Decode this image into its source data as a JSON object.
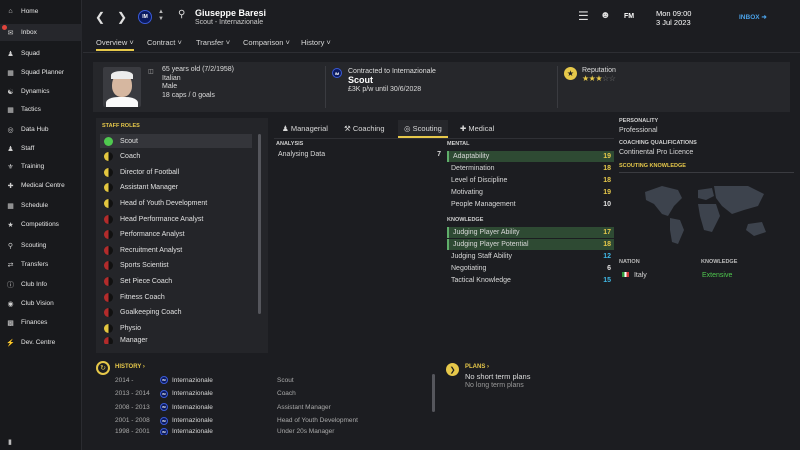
{
  "sidebar": {
    "items": [
      {
        "label": "Home",
        "icon": "home-icon"
      },
      {
        "label": "Inbox",
        "icon": "inbox-icon"
      },
      {
        "label": "Squad",
        "icon": "squad-icon"
      },
      {
        "label": "Squad Planner",
        "icon": "planner-icon"
      },
      {
        "label": "Dynamics",
        "icon": "dynamics-icon"
      },
      {
        "label": "Tactics",
        "icon": "tactics-icon"
      },
      {
        "label": "Data Hub",
        "icon": "datahub-icon"
      },
      {
        "label": "Staff",
        "icon": "staff-icon"
      },
      {
        "label": "Training",
        "icon": "training-icon"
      },
      {
        "label": "Medical Centre",
        "icon": "medical-icon"
      },
      {
        "label": "Schedule",
        "icon": "schedule-icon"
      },
      {
        "label": "Competitions",
        "icon": "trophy-icon"
      },
      {
        "label": "Scouting",
        "icon": "scouting-icon"
      },
      {
        "label": "Transfers",
        "icon": "transfers-icon"
      },
      {
        "label": "Club Info",
        "icon": "clubinfo-icon"
      },
      {
        "label": "Club Vision",
        "icon": "vision-icon"
      },
      {
        "label": "Finances",
        "icon": "finances-icon"
      },
      {
        "label": "Dev. Centre",
        "icon": "devcentre-icon"
      }
    ]
  },
  "header": {
    "name": "Giuseppe Baresi",
    "subtitle": "Scout - Internazionale",
    "fm": "FM",
    "day": "Mon 09:00",
    "date": "3 Jul 2023",
    "inbox": "INBOX"
  },
  "subnav": {
    "tabs": [
      "Overview",
      "Contract",
      "Transfer",
      "Comparison",
      "History"
    ]
  },
  "profile": {
    "age": "65 years old (7/2/1958)",
    "nationality": "Italian",
    "gender": "Male",
    "caps": "18 caps / 0 goals",
    "contract_label": "Contracted to Internazionale",
    "role": "Scout",
    "wage": "£3K p/w until 30/6/2028",
    "reputation_label": "Reputation",
    "reputation_stars": 3
  },
  "staff_roles": {
    "title": "STAFF ROLES",
    "roles": [
      {
        "label": "Scout",
        "dot": "full-g"
      },
      {
        "label": "Coach",
        "dot": "half-y"
      },
      {
        "label": "Director of Football",
        "dot": "half-y"
      },
      {
        "label": "Assistant Manager",
        "dot": "half-y"
      },
      {
        "label": "Head of Youth Development",
        "dot": "half-y"
      },
      {
        "label": "Head Performance Analyst",
        "dot": "half-r"
      },
      {
        "label": "Performance Analyst",
        "dot": "half-r"
      },
      {
        "label": "Recruitment Analyst",
        "dot": "half-r"
      },
      {
        "label": "Sports Scientist",
        "dot": "half-r"
      },
      {
        "label": "Set Piece Coach",
        "dot": "half-r"
      },
      {
        "label": "Fitness Coach",
        "dot": "half-r"
      },
      {
        "label": "Goalkeeping Coach",
        "dot": "half-r"
      },
      {
        "label": "Physio",
        "dot": "half-y"
      },
      {
        "label": "Manager",
        "dot": "half-r"
      }
    ]
  },
  "attr_tabs": [
    "Managerial",
    "Coaching",
    "Scouting",
    "Medical"
  ],
  "analysis": {
    "title": "ANALYSIS",
    "items": [
      {
        "label": "Analysing Data",
        "value": "7"
      }
    ]
  },
  "mental": {
    "title": "MENTAL",
    "items": [
      {
        "label": "Adaptability",
        "value": "19",
        "hl": true
      },
      {
        "label": "Determination",
        "value": "18",
        "hl": false
      },
      {
        "label": "Level of Discipline",
        "value": "18",
        "hl": false
      },
      {
        "label": "Motivating",
        "value": "19",
        "hl": false
      },
      {
        "label": "People Management",
        "value": "10",
        "hl": false
      }
    ]
  },
  "knowledge": {
    "title": "KNOWLEDGE",
    "items": [
      {
        "label": "Judging Player Ability",
        "value": "17",
        "hl": true
      },
      {
        "label": "Judging Player Potential",
        "value": "18",
        "hl": true
      },
      {
        "label": "Judging Staff Ability",
        "value": "12",
        "hl": false
      },
      {
        "label": "Negotiating",
        "value": "6",
        "hl": false
      },
      {
        "label": "Tactical Knowledge",
        "value": "15",
        "hl": false
      }
    ]
  },
  "right": {
    "personality_title": "PERSONALITY",
    "personality": "Professional",
    "coaching_title": "COACHING QUALIFICATIONS",
    "coaching": "Continental Pro Licence",
    "scouting_title": "SCOUTING KNOWLEDGE",
    "nation_label": "NATION",
    "knowledge_label": "KNOWLEDGE",
    "nation": "Italy",
    "knowledge": "Extensive"
  },
  "history": {
    "title": "HISTORY",
    "rows": [
      {
        "years": "2014 -",
        "club": "Internazionale",
        "role": "Scout"
      },
      {
        "years": "2013 - 2014",
        "club": "Internazionale",
        "role": "Coach"
      },
      {
        "years": "2008 - 2013",
        "club": "Internazionale",
        "role": "Assistant Manager"
      },
      {
        "years": "2001 - 2008",
        "club": "Internazionale",
        "role": "Head of Youth Development"
      },
      {
        "years": "1998 - 2001",
        "club": "Internazionale",
        "role": "Under 20s Manager"
      }
    ]
  },
  "plans": {
    "title": "PLANS",
    "short": "No short term plans",
    "long": "No long term plans"
  },
  "colors": {
    "accent": "#e6c84a",
    "highlight": "#2e4a33",
    "value_yellow": "#e6c84a",
    "value_cyan": "#3fb8e6",
    "extensive": "#4fc94f"
  }
}
